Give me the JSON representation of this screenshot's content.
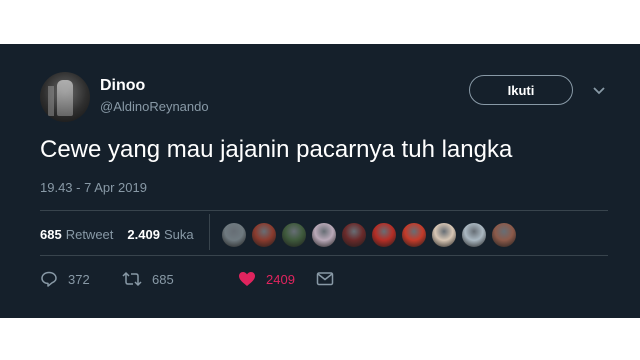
{
  "user": {
    "display_name": "Dinoo",
    "handle": "@AldinoReynando"
  },
  "follow_button": {
    "label": "Ikuti"
  },
  "tweet": {
    "text": "Cewe yang mau jajanin pacarnya tuh langka",
    "timestamp": "19.43 - 7 Apr 2019"
  },
  "stats": {
    "retweets_count": "685",
    "retweets_label": "Retweet",
    "likes_count": "2.409",
    "likes_label": "Suka"
  },
  "liker_avatars": [
    {
      "color": "#6f7a80"
    },
    {
      "color": "#8a3b2e"
    },
    {
      "color": "#3f5a3c"
    },
    {
      "color": "#b9a9b8"
    },
    {
      "color": "#6a2a2a"
    },
    {
      "color": "#b52e26"
    },
    {
      "color": "#c43b2a"
    },
    {
      "color": "#d7c6b4"
    },
    {
      "color": "#aab8c2"
    },
    {
      "color": "#8c5a4a"
    }
  ],
  "actions": {
    "reply_count": "372",
    "retweet_count": "685",
    "like_count": "2409"
  },
  "icons": [
    "chevron-down-icon",
    "reply-icon",
    "retweet-icon",
    "heart-icon",
    "message-icon"
  ],
  "colors": {
    "background": "#15202b",
    "secondary_text": "#8899a6",
    "like": "#e0245e",
    "divider": "#38444d"
  }
}
